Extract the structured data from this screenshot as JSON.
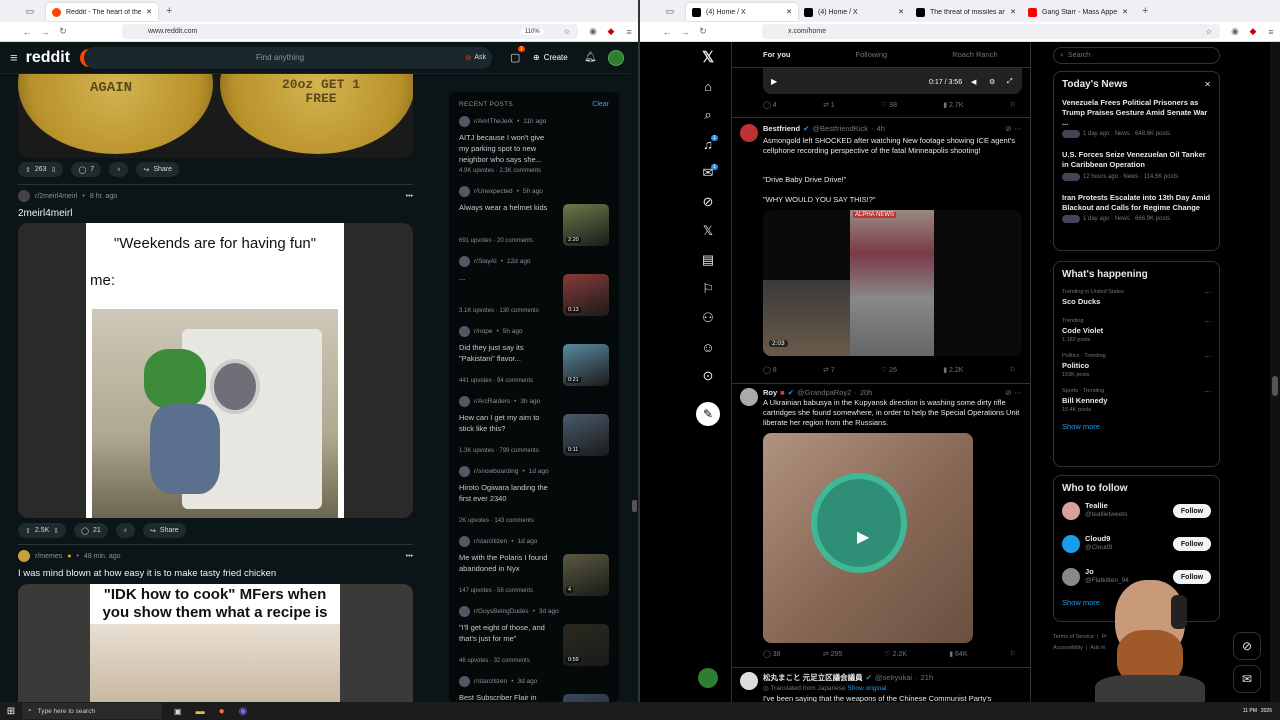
{
  "left_browser": {
    "tabs": [
      {
        "title": "Reddit - The heart of the intern"
      }
    ],
    "url": "www.reddit.com",
    "zoom": "110%"
  },
  "right_browser": {
    "tabs": [
      {
        "title": "(4) Home / X"
      },
      {
        "title": "(4) Home / X"
      },
      {
        "title": "The threat of missiles and d"
      },
      {
        "title": "Gang Starr - Mass Appeal - You"
      }
    ],
    "url": "x.com/home"
  },
  "reddit": {
    "logo": "reddit",
    "search_placeholder": "Find anything",
    "ask_label": "Ask",
    "create_label": "Create",
    "chat_badge": "1",
    "post1": {
      "image_text_left": "AGAIN",
      "image_text_right": "20oz GET 1 FREE",
      "votes": "263",
      "comments": "7",
      "share": "Share"
    },
    "post2": {
      "subreddit": "r/2meirl4meirl",
      "time": "8 hr. ago",
      "title": "2meirl4meirl",
      "meme_top": "\"Weekends are for having fun\"",
      "meme_me": "me:",
      "votes": "2.5K",
      "comments": "21",
      "share": "Share"
    },
    "post3": {
      "subreddit": "r/memes",
      "time": "48 min. ago",
      "title": "I was mind blown at how easy it is to make tasty fried chicken",
      "meme_text": "\"IDK how to cook\" MFers when you show them what a recipe is"
    },
    "recent": {
      "header": "RECENT POSTS",
      "clear": "Clear",
      "items": [
        {
          "sub": "r/AmITheJerk",
          "time": "11h ago",
          "title": "AITJ because I won't give my parking spot to new neighbor who says she...",
          "stats": "4.9K upvotes · 2.3K comments",
          "thumb": "",
          "img": false
        },
        {
          "sub": "r/Unexpected",
          "time": "5h ago",
          "title": "Always wear a helmet kids",
          "stats": "691 upvotes · 20 comments",
          "thumb": "2:20",
          "img": true
        },
        {
          "sub": "r/SlayAI",
          "time": "12d ago",
          "title": "...",
          "stats": "3.1K upvotes · 130 comments",
          "thumb": "0:13",
          "img": true
        },
        {
          "sub": "r/nope",
          "time": "5h ago",
          "title": "Did they just say its \"Pakistani\" flavor...",
          "stats": "441 upvotes · 94 comments",
          "thumb": "0:21",
          "img": true
        },
        {
          "sub": "r/ArcRaiders",
          "time": "3h ago",
          "title": "How can I get my aim to stick like this?",
          "stats": "1.3K upvotes · 799 comments",
          "thumb": "0:11",
          "img": true
        },
        {
          "sub": "r/snowboarding",
          "time": "1d ago",
          "title": "Hiroto Ogiwara landing the first ever 2340",
          "stats": "2K upvotes · 143 comments",
          "thumb": "",
          "img": false
        },
        {
          "sub": "r/starcitizen",
          "time": "1d ago",
          "title": "Me with the Polaris I found abandoned in Nyx",
          "stats": "147 upvotes · 58 comments",
          "thumb": "4",
          "img": true
        },
        {
          "sub": "r/GuysBeingDudes",
          "time": "3d ago",
          "title": "\"I'll get eight of those, and that's just for me\"",
          "stats": "46 upvotes · 32 comments",
          "thumb": "0:59",
          "img": true
        },
        {
          "sub": "r/starcitizen",
          "time": "3d ago",
          "title": "Best Subscriber Flair in",
          "stats": "",
          "thumb": "",
          "img": true
        }
      ]
    }
  },
  "x": {
    "tabs": [
      "For you",
      "Following",
      "Roach Ranch"
    ],
    "nav_badges": {
      "notifications": "1",
      "messages": "1"
    },
    "video_time": "0:17 / 3:56",
    "tweet0_stats": {
      "replies": "4",
      "reposts": "1",
      "likes": "38",
      "views": "2.7K"
    },
    "tweet1": {
      "name": "Bestfriend",
      "handle": "@BestfriendKick",
      "time": "4h",
      "text": "Asmongold left SHOCKED after watching New footage showing ICE agent's cellphone recording perspective of the fatal Minneapolis shooting!",
      "line2": "\"Drive Baby Drive Drive!\"",
      "line3": "\"WHY WOULD YOU SAY THIS!?\"",
      "video_time": "2:03",
      "overlay": "ALPHA NEWS",
      "stats": {
        "replies": "8",
        "reposts": "7",
        "likes": "26",
        "views": "2.2K"
      }
    },
    "tweet2": {
      "name": "Roy",
      "handle": "@GrandpaRoy2",
      "time": "20h",
      "text": "A Ukrainian babusya in the Kupyansk direction is washing some dirty rifle cartridges she found somewhere, in order to help the Special Operations Unit liberate her region from the Russians.",
      "stats": {
        "replies": "38",
        "reposts": "295",
        "likes": "2.2K",
        "views": "64K"
      }
    },
    "tweet3": {
      "name": "松丸まこと 元足立区議会議員",
      "handle": "@selryukai",
      "time": "21h",
      "translated": "Translated from Japanese",
      "show_original": "Show original",
      "text": "I've been saying that the weapons of the Chinese Communist Party's"
    },
    "search_placeholder": "Search",
    "news": {
      "title": "Today's News",
      "items": [
        {
          "title": "Venezuela Frees Political Prisoners as Trump Praises Gesture Amid Senate War ...",
          "meta": "1 day ago · News · 648.6K posts"
        },
        {
          "title": "U.S. Forces Seize Venezuelan Oil Tanker in Caribbean Operation",
          "meta": "12 hours ago · News · 114.5K posts"
        },
        {
          "title": "Iran Protests Escalate into 13th Day Amid Blackout and Calls for Regime Change",
          "meta": "1 day ago · News · 666.9K posts"
        }
      ]
    },
    "happening": {
      "title": "What's happening",
      "items": [
        {
          "context": "Trending in United States",
          "title": "Sco Ducks",
          "posts": ""
        },
        {
          "context": "Trending",
          "title": "Code Violet",
          "posts": "1,182 posts"
        },
        {
          "context": "Politics · Trending",
          "title": "Politico",
          "posts": "153K posts"
        },
        {
          "context": "Sports · Trending",
          "title": "Bill Kennedy",
          "posts": "15.4K posts"
        }
      ],
      "show_more": "Show more"
    },
    "who_to_follow": {
      "title": "Who to follow",
      "items": [
        {
          "name": "Teallie",
          "handle": "@teallietweets",
          "button": "Follow"
        },
        {
          "name": "Cloud9",
          "handle": "@Cloud9",
          "button": "Follow"
        },
        {
          "name": "Jo",
          "handle": "@Flatkitten_94",
          "button": "Follow"
        }
      ],
      "show_more": "Show more"
    },
    "footer": {
      "terms": "Terms of Service",
      "privacy": "Pr",
      "accessibility": "Accessibility",
      "ads": "Ads in"
    }
  },
  "taskbar": {
    "search_placeholder": "Type here to search",
    "time": "11 PM",
    "year": "2026"
  }
}
